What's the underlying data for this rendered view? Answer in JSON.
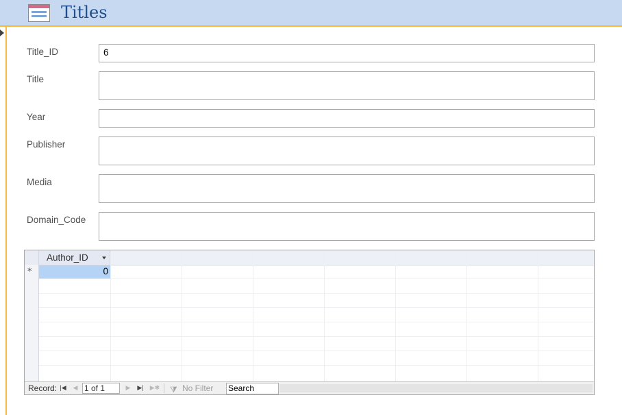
{
  "header": {
    "title": "Titles",
    "icon": "form-icon"
  },
  "fields": [
    {
      "label": "Title_ID",
      "value": "6"
    },
    {
      "label": "Title",
      "value": ""
    },
    {
      "label": "Year",
      "value": ""
    },
    {
      "label": "Publisher",
      "value": ""
    },
    {
      "label": "Media",
      "value": ""
    },
    {
      "label": "Domain_Code",
      "value": ""
    }
  ],
  "subform": {
    "columns": [
      "Author_ID"
    ],
    "new_row_marker": "*",
    "new_row_value": "0"
  },
  "navigation": {
    "record_label": "Record:",
    "position": "1 of 1",
    "filter_label": "No Filter",
    "search_placeholder": "Search"
  }
}
